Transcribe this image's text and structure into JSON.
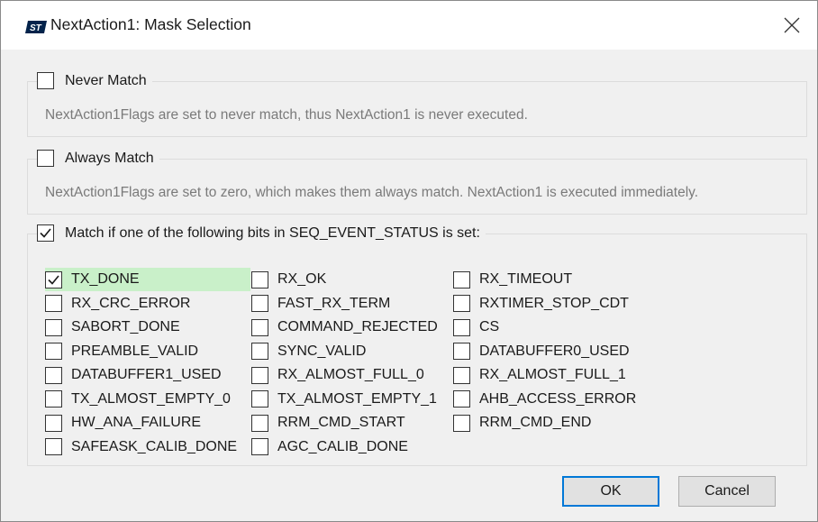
{
  "dialog": {
    "title": "NextAction1: Mask Selection",
    "logo_icon": "st-logo-icon",
    "close_icon": "close-icon"
  },
  "groups": {
    "never": {
      "label": "Never Match",
      "checked": false,
      "description": "NextAction1Flags are set to never match, thus NextAction1 is never executed."
    },
    "always": {
      "label": "Always Match",
      "checked": false,
      "description": "NextAction1Flags are set to zero, which makes them always match. NextAction1 is executed immediately."
    },
    "match": {
      "label": "Match if one of the following bits in SEQ_EVENT_STATUS is set:",
      "checked": true
    }
  },
  "bits": [
    {
      "label": "TX_DONE",
      "checked": true,
      "highlight": true
    },
    {
      "label": "RX_OK",
      "checked": false
    },
    {
      "label": "RX_TIMEOUT",
      "checked": false
    },
    {
      "label": "RX_CRC_ERROR",
      "checked": false
    },
    {
      "label": "FAST_RX_TERM",
      "checked": false
    },
    {
      "label": "RXTIMER_STOP_CDT",
      "checked": false
    },
    {
      "label": "SABORT_DONE",
      "checked": false
    },
    {
      "label": "COMMAND_REJECTED",
      "checked": false
    },
    {
      "label": "CS",
      "checked": false
    },
    {
      "label": "PREAMBLE_VALID",
      "checked": false
    },
    {
      "label": "SYNC_VALID",
      "checked": false
    },
    {
      "label": "DATABUFFER0_USED",
      "checked": false
    },
    {
      "label": "DATABUFFER1_USED",
      "checked": false
    },
    {
      "label": "RX_ALMOST_FULL_0",
      "checked": false
    },
    {
      "label": "RX_ALMOST_FULL_1",
      "checked": false
    },
    {
      "label": "TX_ALMOST_EMPTY_0",
      "checked": false
    },
    {
      "label": "TX_ALMOST_EMPTY_1",
      "checked": false
    },
    {
      "label": "AHB_ACCESS_ERROR",
      "checked": false
    },
    {
      "label": "HW_ANA_FAILURE",
      "checked": false
    },
    {
      "label": "RRM_CMD_START",
      "checked": false
    },
    {
      "label": "RRM_CMD_END",
      "checked": false
    },
    {
      "label": "SAFEASK_CALIB_DONE",
      "checked": false
    },
    {
      "label": "AGC_CALIB_DONE",
      "checked": false
    }
  ],
  "buttons": {
    "ok_label": "OK",
    "cancel_label": "Cancel"
  },
  "colors": {
    "highlight": "#c9f0c9",
    "default_button_border": "#0078d7"
  }
}
